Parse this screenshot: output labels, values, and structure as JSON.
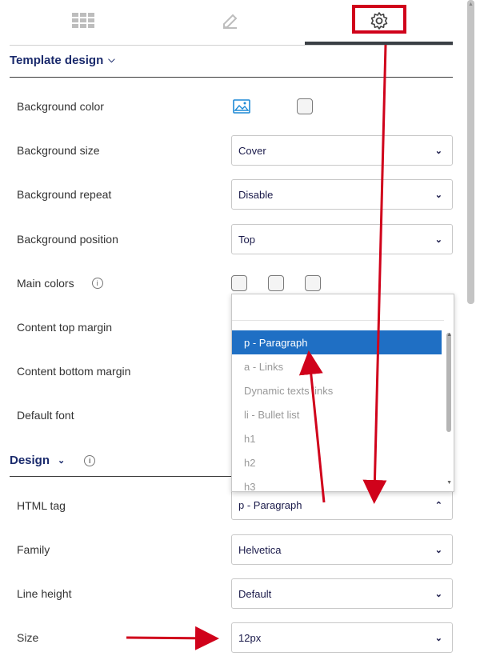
{
  "tabs": [
    {
      "name": "grid-icon"
    },
    {
      "name": "edit-icon"
    },
    {
      "name": "gear-icon",
      "active": true
    }
  ],
  "template_design": {
    "heading": "Template design",
    "rows": {
      "background_color": "Background color",
      "background_size": "Background size",
      "background_repeat": "Background repeat",
      "background_position": "Background position",
      "main_colors": "Main colors",
      "content_top_margin": "Content top margin",
      "content_bottom_margin": "Content bottom margin",
      "default_font": "Default font"
    },
    "values": {
      "background_size": "Cover",
      "background_repeat": "Disable",
      "background_position": "Top"
    }
  },
  "design": {
    "heading": "Design",
    "rows": {
      "html_tag": "HTML tag",
      "family": "Family",
      "line_height": "Line height",
      "size": "Size"
    },
    "values": {
      "html_tag": "p - Paragraph",
      "family": "Helvetica",
      "line_height": "Default",
      "size": "12px"
    }
  },
  "dropdown": {
    "options": [
      "p - Paragraph",
      "a - Links",
      "Dynamic texts links",
      "li - Bullet list",
      "h1",
      "h2",
      "h3"
    ],
    "selected": "p - Paragraph"
  },
  "colors": {
    "accent": "#1f6fc4",
    "annotation": "#d0021b",
    "heading": "#1a2a6c"
  }
}
